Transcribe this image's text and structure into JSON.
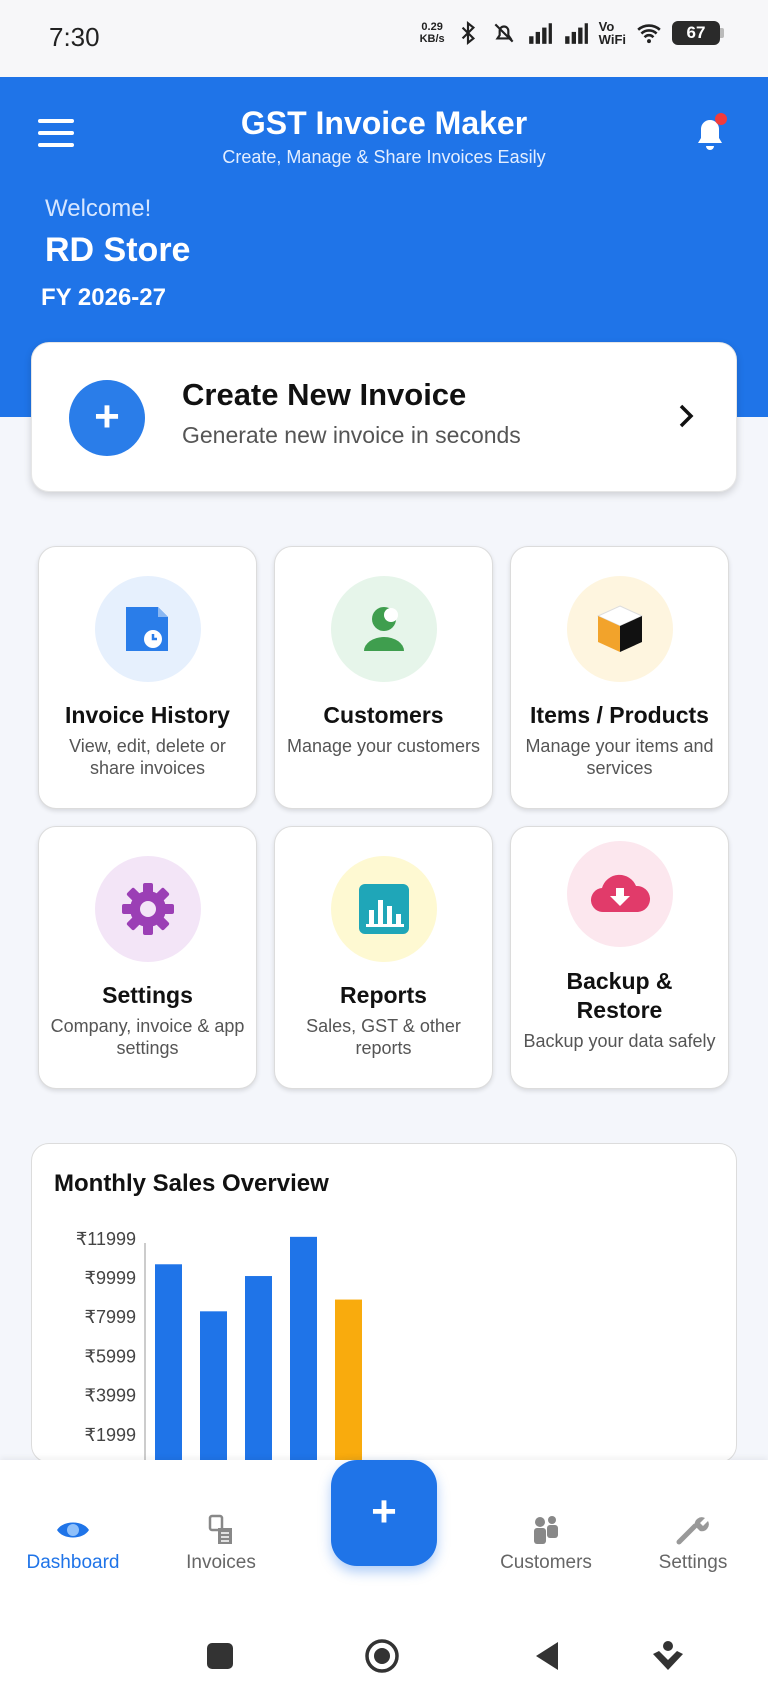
{
  "status_bar": {
    "time": "7:30",
    "net_speed_value": "0.29",
    "net_speed_unit": "KB/s",
    "vowifi_top": "Vo",
    "vowifi_bottom": "WiFi",
    "battery": "67"
  },
  "header": {
    "title": "GST Invoice Maker",
    "subtitle": "Create, Manage & Share Invoices Easily",
    "welcome": "Welcome!",
    "store_name": "RD Store",
    "fiscal_year": "FY 2026-27",
    "colors": {
      "brand": "#1F74E8",
      "notification_dot": "#F23B3B"
    }
  },
  "create_invoice": {
    "title": "Create New Invoice",
    "subtitle": "Generate new invoice in seconds"
  },
  "tiles": [
    {
      "title": "Invoice History",
      "desc": "View, edit, delete or share invoices",
      "icon": "invoice-clock-icon",
      "circle": "#E6F0FD"
    },
    {
      "title": "Customers",
      "desc": "Manage your customers",
      "icon": "customer-icon",
      "circle": "#E6F5EA"
    },
    {
      "title": "Items / Products",
      "desc": "Manage your items and services",
      "icon": "box-icon",
      "circle": "#FEF5DF"
    },
    {
      "title": "Settings",
      "desc": "Company, invoice & app settings",
      "icon": "gear-icon",
      "circle": "#F3E5F7"
    },
    {
      "title": "Reports",
      "desc": "Sales, GST & other reports",
      "icon": "bar-chart-icon",
      "circle": "#FEF9D2"
    },
    {
      "title": "Backup & Restore",
      "desc": "Backup your data safely",
      "icon": "cloud-download-icon",
      "circle": "#FCE7EE"
    }
  ],
  "sales_overview": {
    "title": "Monthly Sales Overview"
  },
  "chart_data": {
    "type": "bar",
    "title": "Monthly Sales Overview",
    "y_ticks": [
      "₹11999",
      "₹9999",
      "₹7999",
      "₹5999",
      "₹3999",
      "₹1999"
    ],
    "y_tick_values": [
      11999,
      9999,
      7999,
      5999,
      3999,
      1999
    ],
    "values": [
      10700,
      8300,
      10100,
      12100,
      8900
    ],
    "bar_colors": [
      "#1F74E8",
      "#1F74E8",
      "#1F74E8",
      "#1F74E8",
      "#F9AB0D"
    ],
    "ylim": [
      0,
      12500
    ]
  },
  "bottom_nav": {
    "items": [
      {
        "label": "Dashboard",
        "icon": "eye-icon",
        "active": true
      },
      {
        "label": "Invoices",
        "icon": "invoices-icon",
        "active": false
      },
      {
        "label": "Customers",
        "icon": "customers-icon",
        "active": false
      },
      {
        "label": "Settings",
        "icon": "wrench-icon",
        "active": false
      }
    ],
    "fab_label": "+"
  }
}
